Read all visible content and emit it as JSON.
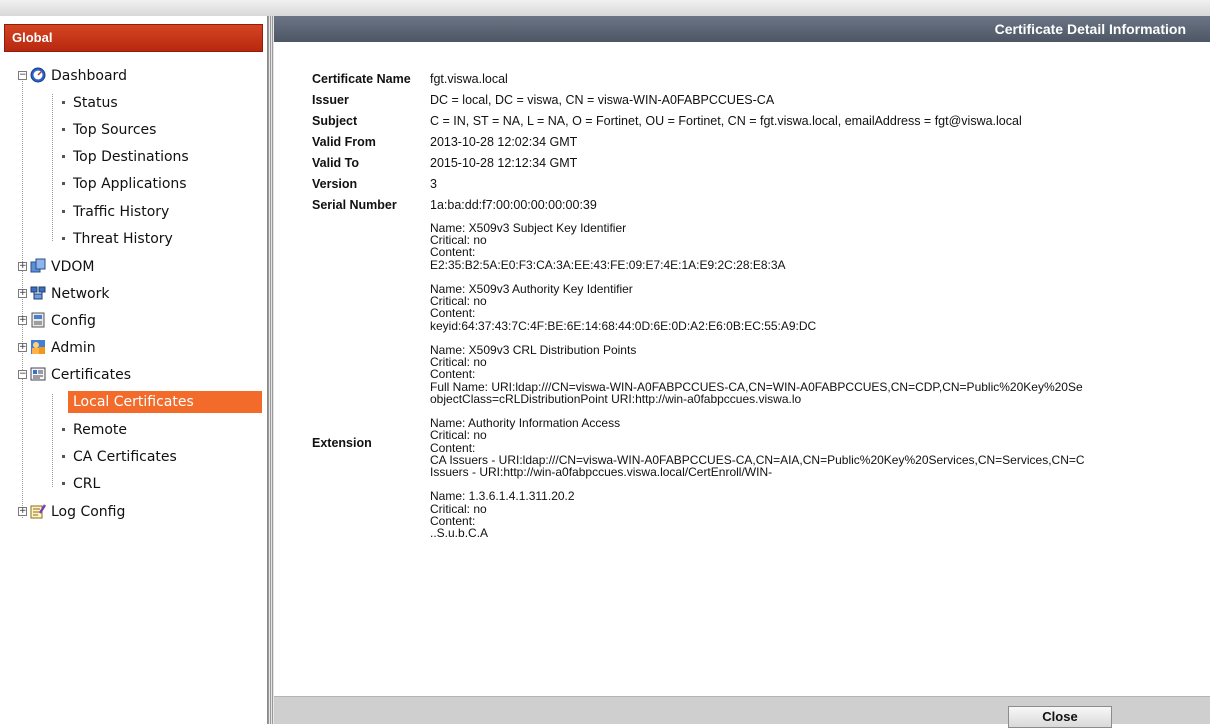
{
  "sidebar": {
    "title": "Global",
    "dashboard": {
      "label": "Dashboard",
      "children": [
        "Status",
        "Top Sources",
        "Top Destinations",
        "Top Applications",
        "Traffic History",
        "Threat History"
      ]
    },
    "vdom": "VDOM",
    "network": "Network",
    "config": "Config",
    "admin": "Admin",
    "certificates": {
      "label": "Certificates",
      "children": [
        "Local Certificates",
        "Remote",
        "CA Certificates",
        "CRL"
      ]
    },
    "log_config": "Log Config"
  },
  "main": {
    "title": "Certificate Detail Information",
    "fields": {
      "certificate_name": {
        "label": "Certificate Name",
        "value": "fgt.viswa.local"
      },
      "issuer": {
        "label": "Issuer",
        "value": "DC = local, DC = viswa, CN = viswa-WIN-A0FABPCCUES-CA"
      },
      "subject": {
        "label": "Subject",
        "value": "C = IN, ST = NA, L = NA, O = Fortinet, OU = Fortinet, CN = fgt.viswa.local, emailAddress = fgt@viswa.local"
      },
      "valid_from": {
        "label": "Valid From",
        "value": "2013-10-28 12:02:34 GMT"
      },
      "valid_to": {
        "label": "Valid To",
        "value": "2015-10-28 12:12:34 GMT"
      },
      "version": {
        "label": "Version",
        "value": "3"
      },
      "serial_number": {
        "label": "Serial Number",
        "value": "1a:ba:dd:f7:00:00:00:00:00:39"
      }
    },
    "extension_label": "Extension",
    "extension_lines": [
      "Name: X509v3 Subject Key Identifier",
      "Critical: no",
      "Content:",
      "E2:35:B2:5A:E0:F3:CA:3A:EE:43:FE:09:E7:4E:1A:E9:2C:28:E8:3A",
      "",
      "Name: X509v3 Authority Key Identifier",
      "Critical: no",
      "Content:",
      "keyid:64:37:43:7C:4F:BE:6E:14:68:44:0D:6E:0D:A2:E6:0B:EC:55:A9:DC",
      "",
      "Name: X509v3 CRL Distribution Points",
      "Critical: no",
      "Content:",
      "Full Name: URI:ldap:///CN=viswa-WIN-A0FABPCCUES-CA,CN=WIN-A0FABPCCUES,CN=CDP,CN=Public%20Key%20Se",
      "objectClass=cRLDistributionPoint URI:http://win-a0fabpccues.viswa.lo",
      "",
      "Name: Authority Information Access",
      "Critical: no",
      "Content:",
      "CA Issuers - URI:ldap:///CN=viswa-WIN-A0FABPCCUES-CA,CN=AIA,CN=Public%20Key%20Services,CN=Services,CN=C",
      "Issuers - URI:http://win-a0fabpccues.viswa.local/CertEnroll/WIN-",
      "",
      "Name: 1.3.6.1.4.1.311.20.2",
      "Critical: no",
      "Content:",
      "..S.u.b.C.A"
    ],
    "close_label": "Close"
  }
}
